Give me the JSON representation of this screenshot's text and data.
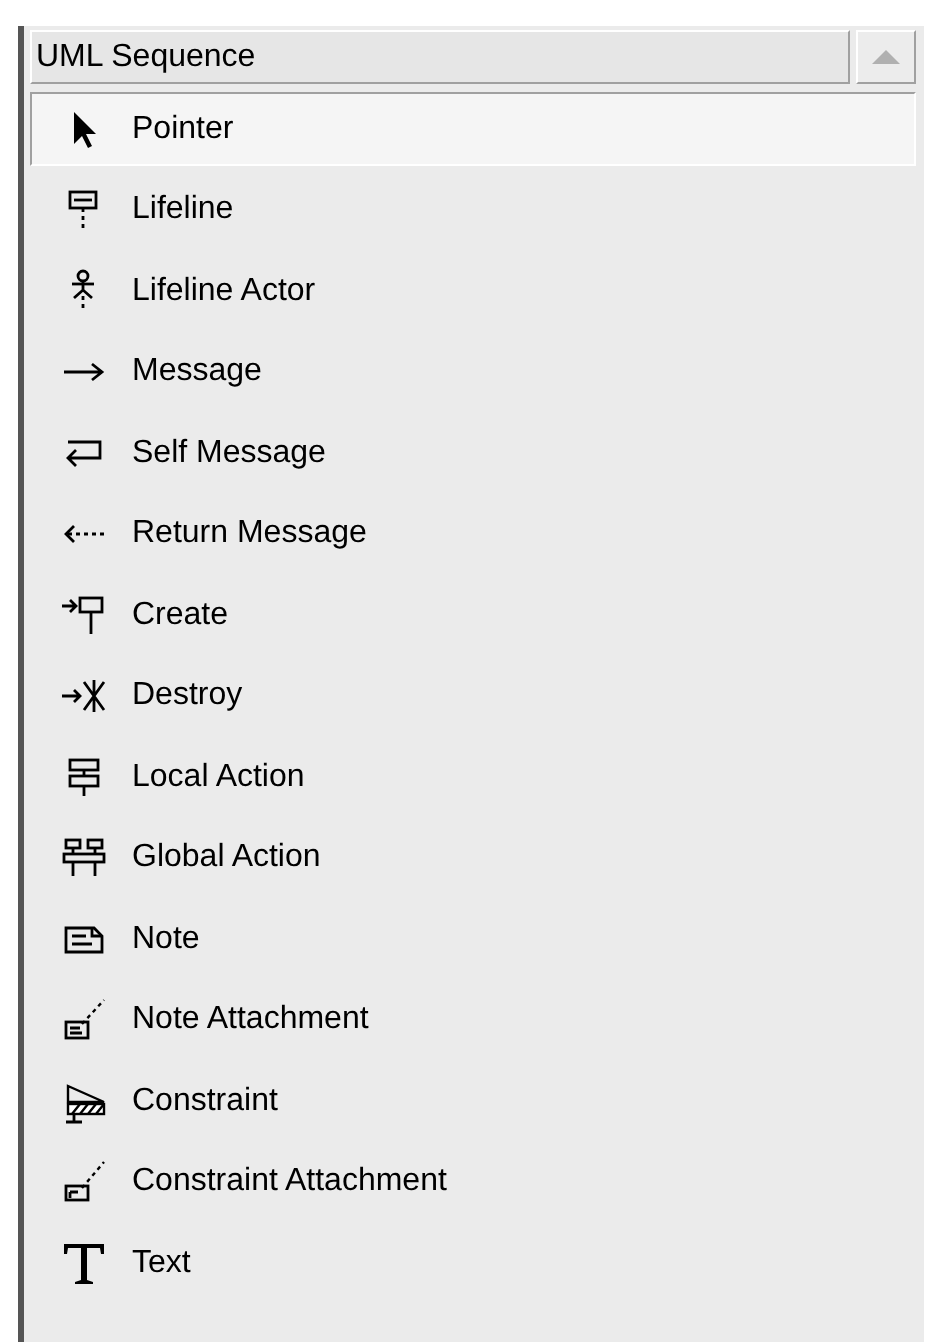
{
  "palette": {
    "title": "UML Sequence",
    "items": [
      {
        "label": "Pointer",
        "selected": true
      },
      {
        "label": "Lifeline",
        "selected": false
      },
      {
        "label": "Lifeline Actor",
        "selected": false
      },
      {
        "label": "Message",
        "selected": false
      },
      {
        "label": "Self Message",
        "selected": false
      },
      {
        "label": "Return Message",
        "selected": false
      },
      {
        "label": "Create",
        "selected": false
      },
      {
        "label": "Destroy",
        "selected": false
      },
      {
        "label": "Local Action",
        "selected": false
      },
      {
        "label": "Global Action",
        "selected": false
      },
      {
        "label": "Note",
        "selected": false
      },
      {
        "label": "Note Attachment",
        "selected": false
      },
      {
        "label": "Constraint",
        "selected": false
      },
      {
        "label": "Constraint Attachment",
        "selected": false
      },
      {
        "label": "Text",
        "selected": false
      }
    ]
  }
}
